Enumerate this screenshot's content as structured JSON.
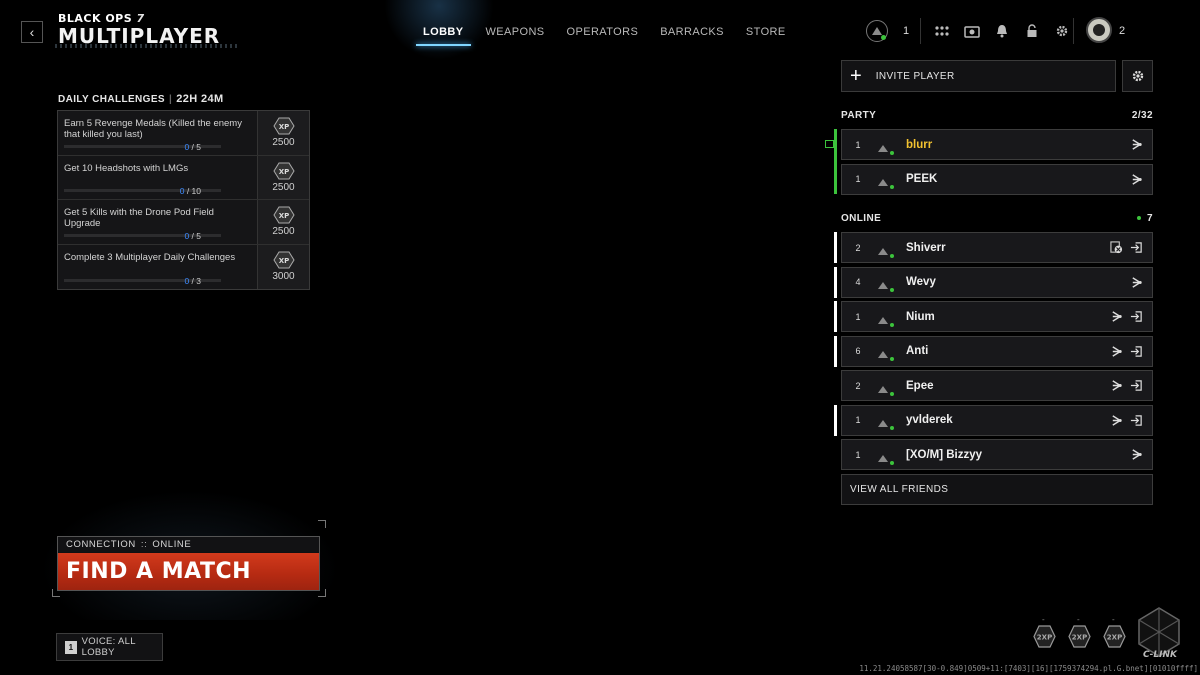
{
  "header": {
    "back_icon": "chevron-left-icon",
    "brand_sub": "BLACK OPS",
    "brand_sub_num": "7",
    "brand_title": "MULTIPLAYER",
    "tabs": [
      {
        "label": "LOBBY",
        "active": true
      },
      {
        "label": "WEAPONS",
        "active": false
      },
      {
        "label": "OPERATORS",
        "active": false
      },
      {
        "label": "BARRACKS",
        "active": false
      },
      {
        "label": "STORE",
        "active": false
      }
    ],
    "rank_count": "1",
    "hud_icons": [
      "grid-icon",
      "camera-icon",
      "bell-icon",
      "lock-icon",
      "gear-icon"
    ],
    "avatar_count": "2"
  },
  "daily": {
    "title": "DAILY CHALLENGES",
    "timer": "22H 24M",
    "challenges": [
      {
        "text": "Earn 5 Revenge Medals (Killed the enemy that killed you last)",
        "current": "0",
        "total": "/ 5",
        "xp_label": "XP",
        "xp": "2500"
      },
      {
        "text": "Get 10 Headshots with LMGs",
        "current": "0",
        "total": "/ 10",
        "xp_label": "XP",
        "xp": "2500"
      },
      {
        "text": "Get 5 Kills with the Drone Pod Field Upgrade",
        "current": "0",
        "total": "/ 5",
        "xp_label": "XP",
        "xp": "2500"
      },
      {
        "text": "Complete 3 Multiplayer Daily Challenges",
        "current": "0",
        "total": "/ 3",
        "xp_label": "XP",
        "xp": "3000"
      }
    ]
  },
  "matchmaking": {
    "connection_label": "CONNECTION",
    "connection_sep": "::",
    "connection_status": "ONLINE",
    "find_match_label": "FIND A MATCH",
    "accent": "#c8321a"
  },
  "voice": {
    "key": "1",
    "label": "VOICE: ALL LOBBY"
  },
  "social": {
    "invite_label": "INVITE PLAYER",
    "party_title": "PARTY",
    "party_count": "2/32",
    "party": [
      {
        "level": "1",
        "name": "blurr",
        "leader": true,
        "icons": [
          "party-icon"
        ]
      },
      {
        "level": "1",
        "name": "PEEK",
        "leader": false,
        "icons": [
          "party-icon"
        ]
      }
    ],
    "online_title": "ONLINE",
    "online_count": "7",
    "online": [
      {
        "level": "2",
        "name": "Shiverr",
        "marker": true,
        "icons": [
          "xbox-icon",
          "join-icon"
        ]
      },
      {
        "level": "4",
        "name": "Wevy",
        "marker": true,
        "icons": [
          "party-icon"
        ]
      },
      {
        "level": "1",
        "name": "Nium",
        "marker": true,
        "icons": [
          "party-icon",
          "join-icon"
        ]
      },
      {
        "level": "6",
        "name": "Anti",
        "marker": true,
        "icons": [
          "party-icon",
          "join-icon"
        ]
      },
      {
        "level": "2",
        "name": "Epee",
        "marker": false,
        "icons": [
          "party-icon",
          "join-icon"
        ]
      },
      {
        "level": "1",
        "name": "yvlderek",
        "marker": true,
        "icons": [
          "party-icon",
          "join-icon"
        ]
      },
      {
        "level": "1",
        "name": "[XO/M] Bizzyy",
        "marker": false,
        "icons": [
          "party-icon"
        ]
      }
    ],
    "view_all_label": "VIEW ALL FRIENDS",
    "online_color": "#3cc33c",
    "leader_color": "#f2c230"
  },
  "footer": {
    "xp_tokens": [
      {
        "label": "2XP",
        "value": "-"
      },
      {
        "label": "2XP",
        "value": "-"
      },
      {
        "label": "2XP",
        "value": "-"
      }
    ],
    "clink_label": "C-LINK",
    "build": "11.21.24058587[30-0.849]0509+11:[7403][16][1759374294.pl.G.bnet][01010ffff]"
  }
}
